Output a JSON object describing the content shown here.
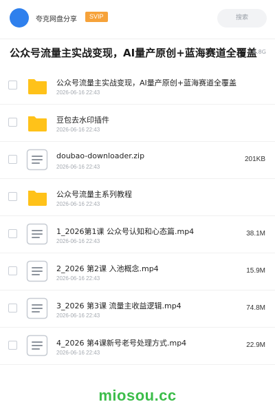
{
  "header": {
    "user_name": "夸克网盘分享",
    "badge": "SVIP",
    "search_placeholder": "搜索"
  },
  "folder": {
    "title": "公众号流量主实战变现，AI量产原创+蓝海赛道全覆盖",
    "total_size": "4.8G"
  },
  "files": [
    {
      "name": "公众号流量主实战变现，AI量产原创+蓝海赛道全覆盖",
      "date": "2026-06-16 22:43",
      "size": "",
      "type": "folder"
    },
    {
      "name": "豆包去水印插件",
      "date": "2026-06-16 22:43",
      "size": "",
      "type": "folder"
    },
    {
      "name": "doubao-downloader.zip",
      "date": "2026-06-16 22:43",
      "size": "201KB",
      "type": "file"
    },
    {
      "name": "公众号流量主系列教程",
      "date": "2026-06-16 22:43",
      "size": "",
      "type": "folder"
    },
    {
      "name": "1_2026第1课 公众号认知和心态篇.mp4",
      "date": "2026-06-16 22:43",
      "size": "38.1M",
      "type": "file"
    },
    {
      "name": "2_2026 第2课 入池概念.mp4",
      "date": "2026-06-16 22:43",
      "size": "15.9M",
      "type": "file"
    },
    {
      "name": "3_2026 第3课 流量主收益逻辑.mp4",
      "date": "2026-06-16 22:43",
      "size": "74.8M",
      "type": "file"
    },
    {
      "name": "4_2026 第4课新号老号处理方式.mp4",
      "date": "2026-06-16 22:43",
      "size": "22.9M",
      "type": "file"
    }
  ],
  "watermark": "miosou.cc",
  "colors": {
    "avatar": "#2f80ed",
    "badge": "#f6a23a",
    "folder_icon": "#ffc21a",
    "watermark": "#3cbd4a"
  }
}
